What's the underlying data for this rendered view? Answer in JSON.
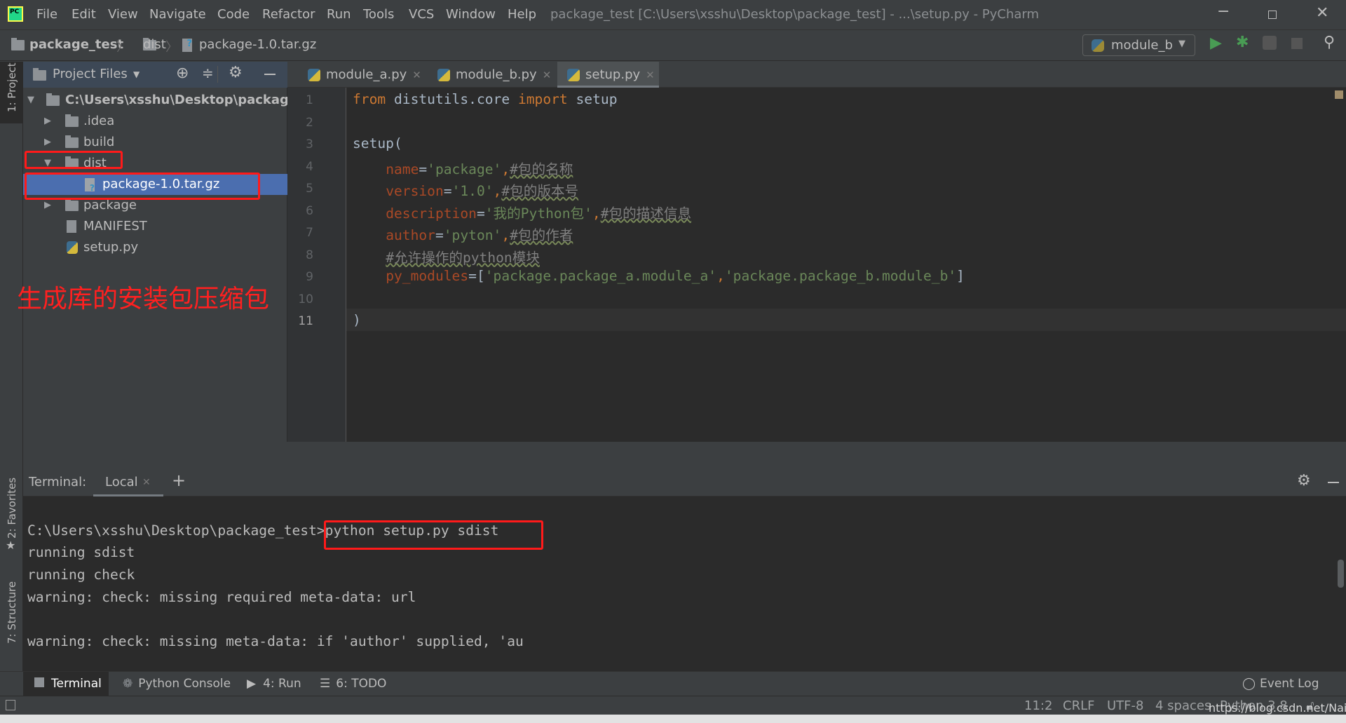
{
  "menubar": {
    "logo": "PC",
    "items": [
      "File",
      "Edit",
      "View",
      "Navigate",
      "Code",
      "Refactor",
      "Run",
      "Tools",
      "VCS",
      "Window",
      "Help"
    ],
    "title": "package_test [C:\\Users\\xsshu\\Desktop\\package_test] - ...\\setup.py - PyCharm"
  },
  "breadcrumb": [
    "package_test",
    "dist",
    "package-1.0.tar.gz"
  ],
  "run_config": {
    "label": "module_b",
    "accent": "#499c54"
  },
  "project": {
    "header": "Project Files",
    "strip_label": "1: Project",
    "tree": [
      {
        "label": "C:\\Users\\xsshu\\Desktop\\package_t",
        "type": "folder",
        "expanded": true
      },
      {
        "label": ".idea",
        "type": "folder",
        "expanded": false
      },
      {
        "label": "build",
        "type": "folder",
        "expanded": false
      },
      {
        "label": "dist",
        "type": "folder",
        "expanded": true
      },
      {
        "label": "package-1.0.tar.gz",
        "type": "archive",
        "selected": true
      },
      {
        "label": "package",
        "type": "folder",
        "expanded": false
      },
      {
        "label": "MANIFEST",
        "type": "text"
      },
      {
        "label": "setup.py",
        "type": "python"
      }
    ],
    "annotation": "生成库的安装包压缩包"
  },
  "tabs": [
    {
      "label": "module_a.py",
      "active": false
    },
    {
      "label": "module_b.py",
      "active": false
    },
    {
      "label": "setup.py",
      "active": true
    }
  ],
  "editor": {
    "line_numbers": [
      "1",
      "2",
      "3",
      "4",
      "5",
      "6",
      "7",
      "8",
      "9",
      "10",
      "11"
    ],
    "lines": [
      [
        {
          "t": "from",
          "c": "kw"
        },
        {
          "t": " distutils.core ",
          "c": ""
        },
        {
          "t": "import",
          "c": "kw"
        },
        {
          "t": " setup",
          "c": ""
        }
      ],
      [],
      [
        {
          "t": "setup(",
          "c": ""
        }
      ],
      [
        {
          "t": "    ",
          "c": ""
        },
        {
          "t": "name",
          "c": "par"
        },
        {
          "t": "=",
          "c": ""
        },
        {
          "t": "'package'",
          "c": "str"
        },
        {
          "t": ",",
          "c": "kw"
        },
        {
          "t": "#包的名称",
          "c": "cm"
        }
      ],
      [
        {
          "t": "    ",
          "c": ""
        },
        {
          "t": "version",
          "c": "par"
        },
        {
          "t": "=",
          "c": ""
        },
        {
          "t": "'1.0'",
          "c": "str"
        },
        {
          "t": ",",
          "c": "kw"
        },
        {
          "t": "#包的版本号",
          "c": "cm"
        }
      ],
      [
        {
          "t": "    ",
          "c": ""
        },
        {
          "t": "description",
          "c": "par"
        },
        {
          "t": "=",
          "c": ""
        },
        {
          "t": "'我的Python包'",
          "c": "str"
        },
        {
          "t": ",",
          "c": "kw"
        },
        {
          "t": "#包的描述信息",
          "c": "cm"
        }
      ],
      [
        {
          "t": "    ",
          "c": ""
        },
        {
          "t": "author",
          "c": "par"
        },
        {
          "t": "=",
          "c": ""
        },
        {
          "t": "'pyton'",
          "c": "str"
        },
        {
          "t": ",",
          "c": "kw"
        },
        {
          "t": "#包的作者",
          "c": "cm"
        }
      ],
      [
        {
          "t": "    ",
          "c": ""
        },
        {
          "t": "#允许操作的python模块",
          "c": "cm"
        }
      ],
      [
        {
          "t": "    ",
          "c": ""
        },
        {
          "t": "py_modules",
          "c": "par"
        },
        {
          "t": "=[",
          "c": ""
        },
        {
          "t": "'package.package_a.module_a'",
          "c": "str"
        },
        {
          "t": ",",
          "c": "kw"
        },
        {
          "t": "'package.package_b.module_b'",
          "c": "str"
        },
        {
          "t": "]",
          "c": ""
        }
      ],
      [],
      [
        {
          "t": ")",
          "c": ""
        }
      ]
    ]
  },
  "terminal": {
    "label": "Terminal:",
    "session_tab": "Local",
    "add": "+",
    "lines": [
      "",
      "C:\\Users\\xsshu\\Desktop\\package_test>python setup.py sdist",
      "running sdist",
      "running check",
      "warning: check: missing required meta-data: url",
      "",
      "warning: check: missing meta-data: if 'author' supplied, 'au"
    ]
  },
  "left_strip": [
    "1: Project",
    "2: Favorites",
    "7: Structure"
  ],
  "toolwindows": [
    {
      "label": "Terminal",
      "active": true
    },
    {
      "label": "Python Console"
    },
    {
      "label": "4: Run"
    },
    {
      "label": "6: TODO"
    }
  ],
  "event_log": "Event Log",
  "status": {
    "position": "11:2",
    "line_sep": "CRLF",
    "encoding": "UTF-8",
    "indent": "4 spaces",
    "interpreter": "Python 3.8",
    "watermark": "https://blog.csdn.net/Naiva"
  }
}
